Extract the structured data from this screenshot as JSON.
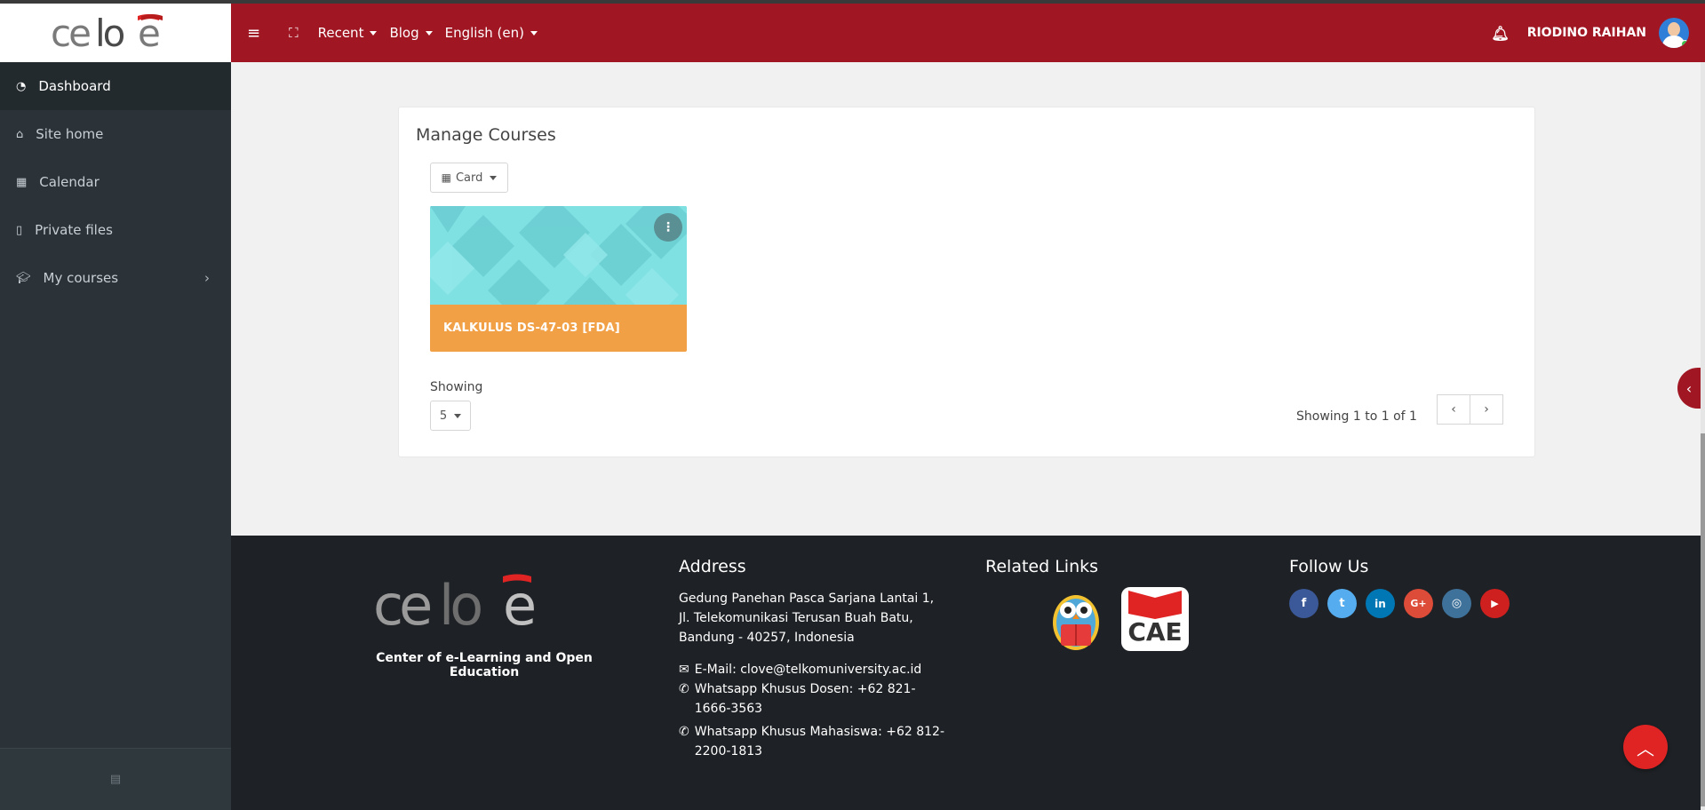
{
  "navbar": {
    "logo_text": "celoe",
    "menu_icon": "hamburger-icon",
    "fullscreen_icon": "fullscreen-icon",
    "items": [
      {
        "label": "Recent"
      },
      {
        "label": "Blog"
      },
      {
        "label": "English (en)"
      }
    ],
    "notification_icon": "bell-icon",
    "user_name": "RIODINO RAIHAN",
    "accent": "#a01623"
  },
  "sidebar": {
    "items": [
      {
        "label": "Dashboard",
        "icon": "dashboard-icon",
        "active": true
      },
      {
        "label": "Site home",
        "icon": "home-icon"
      },
      {
        "label": "Calendar",
        "icon": "calendar-icon"
      },
      {
        "label": "Private files",
        "icon": "file-icon"
      },
      {
        "label": "My courses",
        "icon": "graduation-cap-icon"
      }
    ],
    "bottom_icon": "archive-icon"
  },
  "courses": {
    "title": "Manage Courses",
    "view_label": "Card",
    "items": [
      {
        "name": "KALKULUS DS-47-03 [FDA]",
        "color": "#f1a046"
      }
    ],
    "showing_label": "Showing",
    "per_page": "5",
    "pager_text": "Showing 1 to 1 of 1",
    "prev": "‹",
    "next": "›"
  },
  "footer": {
    "tagline": "Center of e-Learning and Open Education",
    "address_heading": "Address",
    "address": "Gedung Panehan Pasca Sarjana Lantai 1, Jl. Telekomunikasi Terusan Buah Batu, Bandung - 40257, Indonesia",
    "email": "E-Mail: clove@telkomuniversity.ac.id",
    "wa_dosen": "Whatsapp Khusus Dosen: +62 821-1666-3563",
    "wa_mahasiswa": "Whatsapp Khusus Mahasiswa: +62 812-2200-1813",
    "related_heading": "Related Links",
    "cae_text": "CAE",
    "follow_heading": "Follow Us",
    "social": [
      {
        "icon": "facebook-icon",
        "glyph": "f",
        "color": "#3b5998"
      },
      {
        "icon": "twitter-icon",
        "glyph": "t",
        "color": "#55acee"
      },
      {
        "icon": "linkedin-icon",
        "glyph": "in",
        "color": "#0077b5"
      },
      {
        "icon": "google-plus-icon",
        "glyph": "G+",
        "color": "#dd4b39"
      },
      {
        "icon": "instagram-icon",
        "glyph": "◎",
        "color": "#3f729b"
      },
      {
        "icon": "youtube-icon",
        "glyph": "▶",
        "color": "#cd201f"
      }
    ]
  }
}
